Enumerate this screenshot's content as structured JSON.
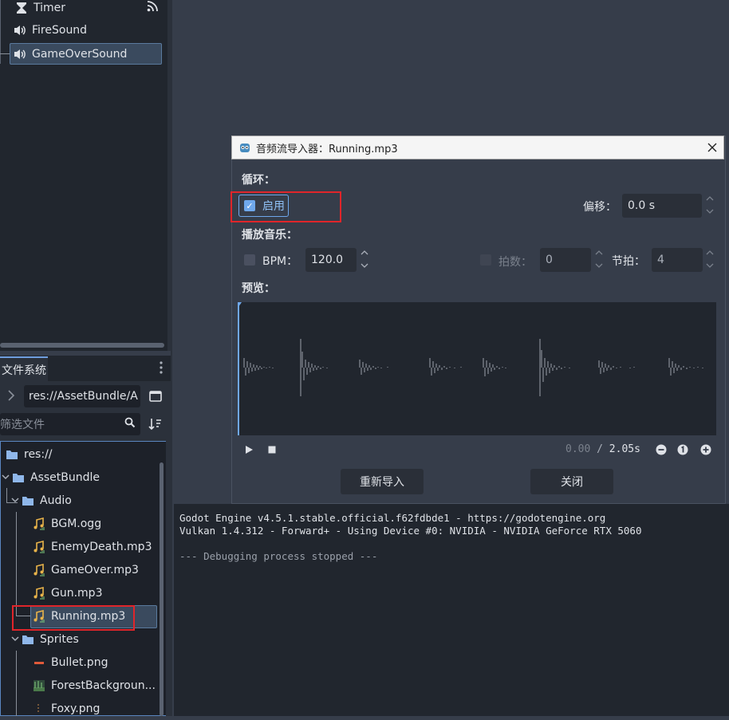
{
  "scene": {
    "nodes": [
      {
        "label": "Timer",
        "icon": "hourglass-icon"
      },
      {
        "label": "FireSound",
        "icon": "speaker-icon"
      },
      {
        "label": "GameOverSound",
        "icon": "speaker-icon"
      }
    ]
  },
  "filesystem": {
    "tab_label": "文件系统",
    "path": "res://AssetBundle/A",
    "filter_placeholder": "筛选文件",
    "tree": [
      {
        "label": "res://",
        "type": "folder"
      },
      {
        "label": "AssetBundle",
        "type": "folder"
      },
      {
        "label": "Audio",
        "type": "folder"
      },
      {
        "label": "BGM.ogg",
        "type": "audio"
      },
      {
        "label": "EnemyDeath.mp3",
        "type": "audio"
      },
      {
        "label": "GameOver.mp3",
        "type": "audio"
      },
      {
        "label": "Gun.mp3",
        "type": "audio"
      },
      {
        "label": "Running.mp3",
        "type": "audio"
      },
      {
        "label": "Sprites",
        "type": "folder"
      },
      {
        "label": "Bullet.png",
        "type": "image"
      },
      {
        "label": "ForestBackgroun...",
        "type": "image"
      },
      {
        "label": "Foxy.png",
        "type": "image"
      }
    ]
  },
  "dialog": {
    "title": "音频流导入器：Running.mp3",
    "loop_section": "循环：",
    "enable_label": "启用",
    "enable_checked": true,
    "offset_label": "偏移：",
    "offset_value": "0.0 s",
    "music_section": "播放音乐：",
    "bpm_label": "BPM：",
    "bpm_value": "120.0",
    "beats_label": "拍数：",
    "beats_value": "0",
    "bar_beats_label": "节拍：",
    "bar_beats_value": "4",
    "preview_section": "预览：",
    "time_current": "0.00",
    "time_sep": "/",
    "time_total": "2.05s",
    "reimport_button": "重新导入",
    "close_button": "关闭"
  },
  "console": {
    "lines": [
      "Godot Engine v4.5.1.stable.official.f62fdbde1 - https://godotengine.org",
      "Vulkan 1.4.312 - Forward+ - Using Device #0: NVIDIA - NVIDIA GeForce RTX 5060",
      "",
      "--- Debugging process stopped ---"
    ]
  },
  "colors": {
    "accent": "#6fa8ec",
    "highlight_box": "#e0252a",
    "audio_icon": "#e8b34a"
  }
}
